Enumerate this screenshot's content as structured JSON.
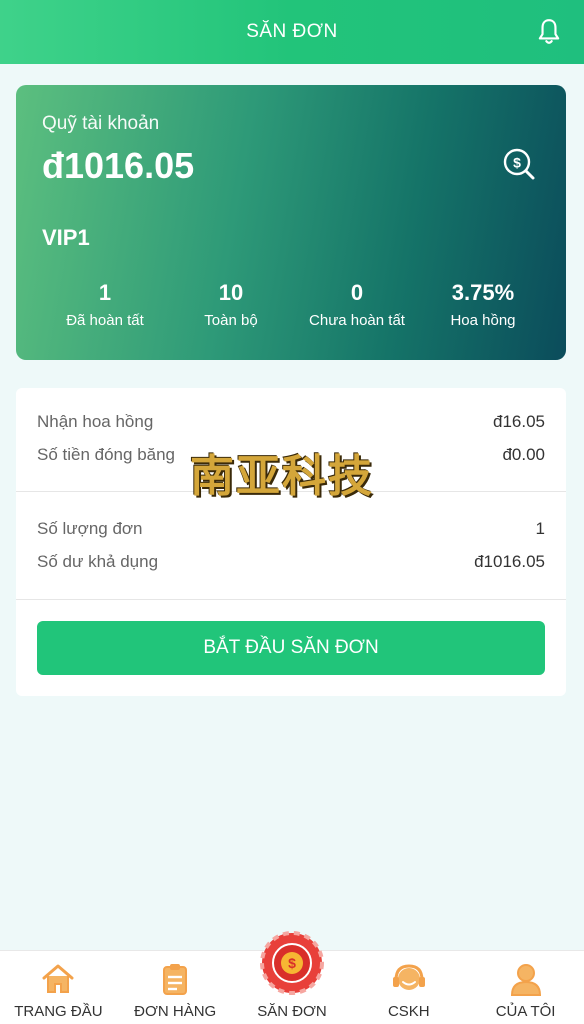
{
  "header": {
    "title": "SĂN ĐƠN",
    "bell_icon": "bell-icon"
  },
  "card": {
    "label": "Quỹ tài khoản",
    "amount": "đ1016.05",
    "vip": "VIP1",
    "stats": [
      {
        "value": "1",
        "label": "Đã hoàn tất"
      },
      {
        "value": "10",
        "label": "Toàn bộ"
      },
      {
        "value": "0",
        "label": "Chưa hoàn tất"
      },
      {
        "value": "3.75%",
        "label": "Hoa hồng"
      }
    ]
  },
  "panel": {
    "commission_label": "Nhận hoa hồng",
    "commission_value": "đ16.05",
    "frozen_label": "Số tiền đóng băng",
    "frozen_value": "đ0.00",
    "orders_label": "Số lượng đơn",
    "orders_value": "1",
    "balance_label": "Số dư khả dụng",
    "balance_value": "đ1016.05",
    "start_button": "BẮT ĐẦU SĂN ĐƠN"
  },
  "watermark": "南亚科技",
  "tabs": [
    {
      "label": "TRANG ĐẦU",
      "icon": "home-icon"
    },
    {
      "label": "ĐƠN HÀNG",
      "icon": "clipboard-icon"
    },
    {
      "label": "SĂN ĐƠN",
      "icon": "coin-icon"
    },
    {
      "label": "CSKH",
      "icon": "headset-icon"
    },
    {
      "label": "CỦA TÔI",
      "icon": "user-icon"
    }
  ],
  "colors": {
    "accent": "#21c57a",
    "tab_icon": "#f3a24b",
    "center_button": "#e8403a"
  }
}
